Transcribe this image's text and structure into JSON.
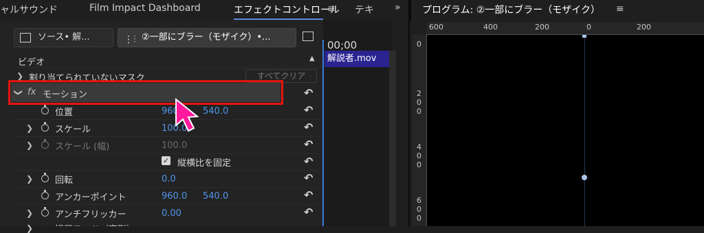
{
  "tabs": {
    "tab1": "ャルサウンド",
    "tab2": "Film Impact Dashboard",
    "tab3": "エフェクトコントロール",
    "tab4": "テキ",
    "overflow": "»",
    "program_title": "プログラム: ②一部にブラー（モザイク）",
    "menu": "≡"
  },
  "effect_controls": {
    "source_label": "ソース• 解...",
    "clip_label": "②一部にブラー（モザイク）•...",
    "section_video": "ビデオ",
    "unassigned_mask": "割り当てられていないマスク",
    "clear_all": "すべてクリア",
    "motion_label": "モーション",
    "fx": "fx",
    "rows": [
      {
        "label": "位置",
        "v1": "960.0",
        "v2": "540.0"
      },
      {
        "label": "スケール",
        "v1": "100.0",
        "v2": ""
      },
      {
        "label": "スケール (幅)",
        "v1": "100.0",
        "v2": ""
      },
      {
        "label": "縦横比を固定",
        "v1": "",
        "v2": ""
      },
      {
        "label": "回転",
        "v1": "0.0",
        "v2": ""
      },
      {
        "label": "アンカーポイント",
        "v1": "960.0",
        "v2": "540.0"
      },
      {
        "label": "アンチフリッカー",
        "v1": "0.00",
        "v2": ""
      },
      {
        "label": "描画モード（変形）",
        "v1": "",
        "v2": ""
      }
    ]
  },
  "timeline": {
    "timecode": "00;00",
    "clip_name": "解説者.mov"
  },
  "program": {
    "ruler_top": [
      "600",
      "400",
      "200",
      "0",
      "200"
    ],
    "ruler_left": [
      "0",
      "2\n0\n0",
      "4\n0\n0",
      "6\n0\n0"
    ]
  },
  "colors": {
    "accent_blue": "#4f95e8",
    "highlight_red": "#e8140f",
    "cursor_pink": "#ff1a9c",
    "clip_purple": "#2a2490"
  }
}
